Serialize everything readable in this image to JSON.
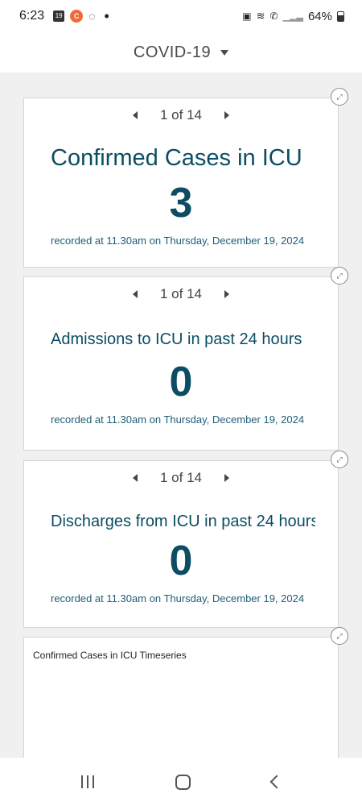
{
  "status_bar": {
    "time": "6:23",
    "calendar_day": "19",
    "battery": "64%"
  },
  "header": {
    "title": "COVID-19"
  },
  "cards": [
    {
      "pager": "1 of 14",
      "title": "Confirmed Cases in ICU",
      "value": "3",
      "note": "recorded at 11.30am on Thursday, December 19, 2024"
    },
    {
      "pager": "1 of 14",
      "title": "Admissions to ICU in past 24 hours",
      "value": "0",
      "note": "recorded at 11.30am on Thursday, December 19, 2024"
    },
    {
      "pager": "1 of 14",
      "title": "Discharges from ICU in past 24 hours",
      "value": "0",
      "note": "recorded at 11.30am on Thursday, December 19, 2024"
    }
  ],
  "timeseries": {
    "title": "Confirmed Cases in ICU Timeseries"
  }
}
